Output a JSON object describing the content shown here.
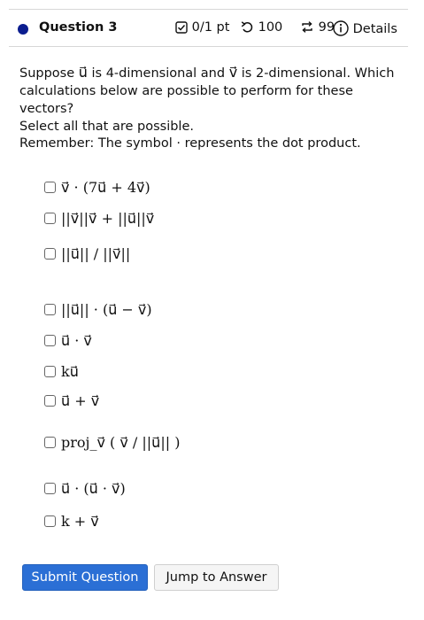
{
  "header": {
    "title": "Question 3",
    "score": "0/1 pt",
    "retries": "100",
    "attempts": "99",
    "details": "Details",
    "accent": "#0b1d8f"
  },
  "question": {
    "prompt": "Suppose ⃗u is 4-dimensional and ⃗v is 2-dimensional. Which calculations below are possible to perform for these vectors? Select all that are possible.",
    "prompt_line1": "Suppose u⃗ is 4-dimensional and v⃗ is 2-dimensional. Which",
    "prompt_line2": "calculations below are possible to perform for these vectors?",
    "prompt_line3": "Select all that are possible.",
    "remember": "Remember: The symbol · represents the dot product."
  },
  "options": [
    "v⃗ · (7u⃗ + 4v⃗)",
    "||v⃗||v⃗ + ||u⃗||v⃗",
    "||u⃗|| / ||v⃗||",
    "||u⃗|| · (u⃗ − v⃗)",
    "u⃗ · v⃗",
    "ku⃗",
    "u⃗ + v⃗",
    "proj_v⃗ ( v⃗ / ||u⃗|| )",
    "u⃗ · (u⃗ · v⃗)",
    "k + v⃗"
  ],
  "buttons": {
    "submit": "Submit Question",
    "jump": "Jump to Answer",
    "submit_color": "#2b6fd5"
  }
}
